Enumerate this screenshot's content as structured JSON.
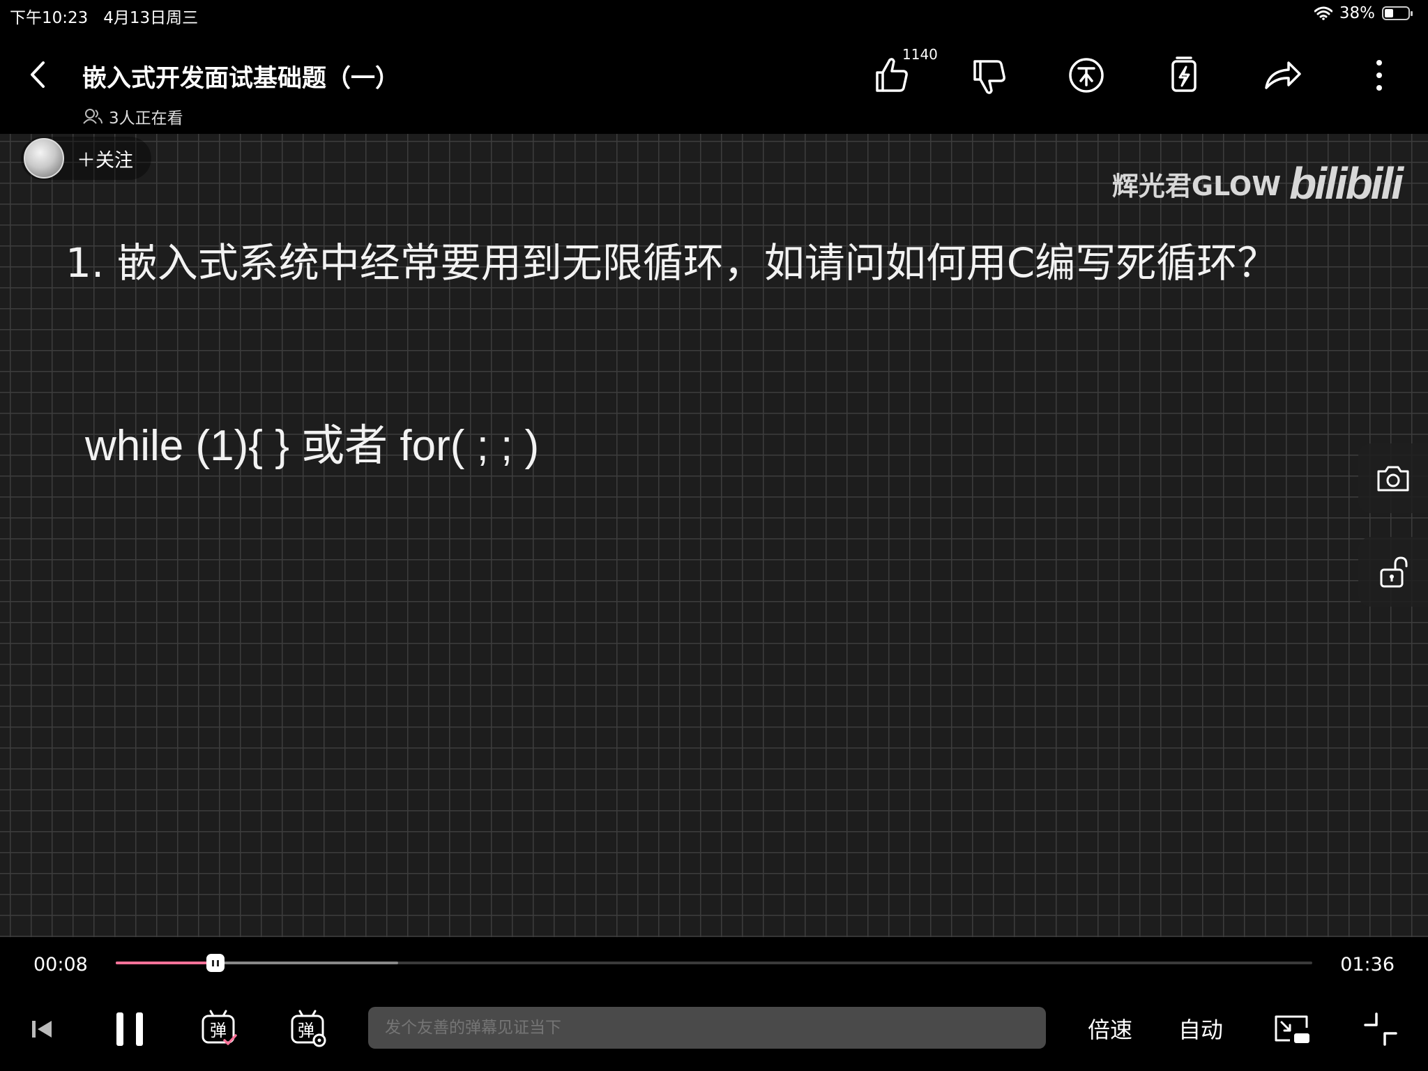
{
  "status_bar": {
    "time": "下午10:23",
    "date": "4月13日周三",
    "battery": "38%",
    "battery_level": 0.38
  },
  "header": {
    "title": "嵌入式开发面试基础题（一）",
    "viewers": "3人正在看",
    "like_count": "1140",
    "icons": [
      "back-icon",
      "thumbs-up-icon",
      "thumbs-down-icon",
      "coin-icon",
      "favorite-icon",
      "share-icon",
      "more-icon"
    ]
  },
  "video": {
    "follow_label": "＋关注",
    "watermark_name": "辉光君GLOW",
    "watermark_logo": "bilibili",
    "question": "1.   嵌入式系统中经常要用到无限循环，如请问如何用C编写死循环？",
    "answer": "while (1){ } 或者 for( ; ; )"
  },
  "player": {
    "current_time": "00:08",
    "total_time": "01:36",
    "progress": 0.0833,
    "buffered": 0.236,
    "danmaku_placeholder": "发个友善的弹幕见证当下",
    "speed_label": "倍速",
    "quality_label": "自动",
    "danmaku_toggle_glyph": "弹",
    "danmaku_settings_glyph": "弹",
    "accent_color": "#fb7299"
  }
}
